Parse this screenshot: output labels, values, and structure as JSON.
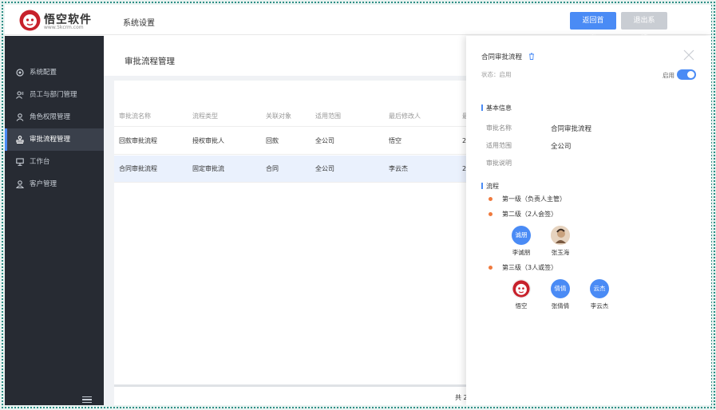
{
  "header": {
    "brand_name": "悟空软件",
    "brand_url": "www.5kcrm.com",
    "title": "系统设置",
    "home_button": "返回首页",
    "logout_button": "退出系统"
  },
  "sidebar": {
    "items": [
      {
        "label": "系统配置",
        "icon": "settings-circle-icon"
      },
      {
        "label": "员工与部门管理",
        "icon": "users-icon"
      },
      {
        "label": "角色权限管理",
        "icon": "user-icon"
      },
      {
        "label": "审批流程管理",
        "icon": "stamp-icon"
      },
      {
        "label": "工作台",
        "icon": "monitor-icon"
      },
      {
        "label": "客户管理",
        "icon": "customer-icon"
      }
    ],
    "active_index": 3
  },
  "main": {
    "page_title": "审批流程管理",
    "table": {
      "headers": [
        "审批流名称",
        "流程类型",
        "关联对象",
        "适用范围",
        "最后修改人",
        "最"
      ],
      "rows": [
        [
          "回款审批流程",
          "授权审批人",
          "回款",
          "全公司",
          "悟空",
          "2"
        ],
        [
          "合同审批流程",
          "固定审批流",
          "合同",
          "全公司",
          "李云杰",
          "2"
        ]
      ]
    },
    "footer_total": "共 2"
  },
  "drawer": {
    "title": "合同审批流程",
    "status": "状态：启用",
    "toggle_label": "启用",
    "toggle_on": true,
    "basic_info_title": "基本信息",
    "fields": [
      {
        "label": "审批名称",
        "value": "合同审批流程"
      },
      {
        "label": "适用范围",
        "value": "全公司"
      },
      {
        "label": "审批说明",
        "value": ""
      }
    ],
    "flow_title": "流程",
    "steps": [
      {
        "label": "第一级（负责人主管）",
        "approvers": []
      },
      {
        "label": "第二级（2人会签）",
        "approvers": [
          {
            "avatar_text": "诚朋",
            "name": "李诚朋",
            "kind": "initials"
          },
          {
            "avatar_text": "",
            "name": "张玉海",
            "kind": "photo"
          }
        ]
      },
      {
        "label": "第三级（3人或签）",
        "approvers": [
          {
            "avatar_text": "",
            "name": "悟空",
            "kind": "logo"
          },
          {
            "avatar_text": "倩倩",
            "name": "张倩倩",
            "kind": "initials"
          },
          {
            "avatar_text": "云杰",
            "name": "李云杰",
            "kind": "initials"
          }
        ]
      }
    ],
    "colors": {
      "accent": "#4a8bf5",
      "step_dot": "#ef7a3e",
      "sidebar_bg": "#272b33"
    }
  }
}
